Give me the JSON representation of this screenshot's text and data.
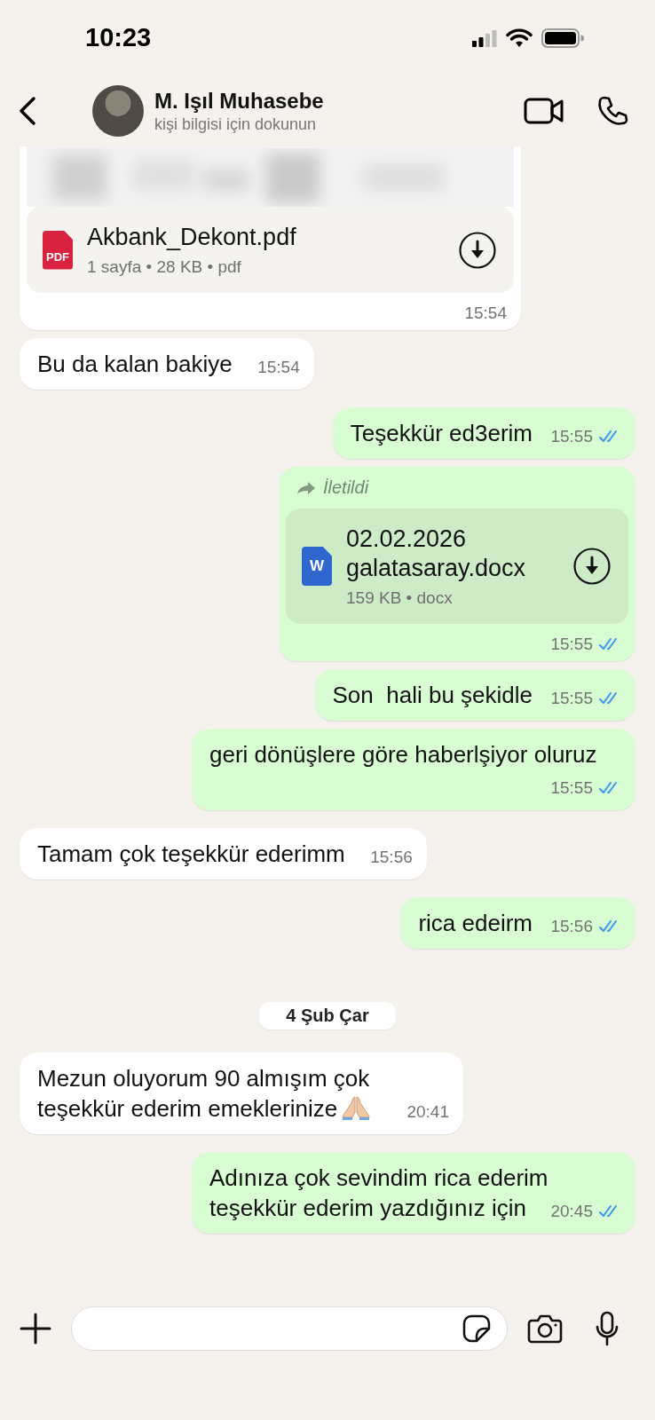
{
  "status_bar": {
    "time": "10:23"
  },
  "header": {
    "name": "M. Işıl Muhasebe",
    "subtitle": "kişi bilgisi için dokunun"
  },
  "messages": [
    {
      "kind": "pdf",
      "outgoing": false,
      "preview": true,
      "icon_label": "PDF",
      "file_name": "Akbank_Dekont.pdf",
      "details": "1 sayfa • 28 KB • pdf",
      "time": "15:54"
    },
    {
      "kind": "text",
      "outgoing": false,
      "text": "Bu da kalan bakiye",
      "time": "15:54"
    },
    {
      "kind": "text",
      "outgoing": true,
      "text": "Teşekkür ed3erim",
      "time": "15:55",
      "read": true
    },
    {
      "kind": "word",
      "outgoing": true,
      "forwarded_label": "İletildi",
      "icon_label": "W",
      "file_name": "02.02.2026 galatasaray.docx",
      "details": "159 KB • docx",
      "time": "15:55",
      "read": true
    },
    {
      "kind": "text",
      "outgoing": true,
      "text": "Son  hali bu şekidle",
      "time": "15:55",
      "read": true
    },
    {
      "kind": "text",
      "outgoing": true,
      "text": "geri dönüşlere göre haberlşiyor oluruz",
      "time": "15:55",
      "read": true
    },
    {
      "kind": "text",
      "outgoing": false,
      "text": "Tamam çok teşekkür ederimm",
      "time": "15:56"
    },
    {
      "kind": "text",
      "outgoing": true,
      "text": "rica edeirm",
      "time": "15:56",
      "read": true
    },
    {
      "kind": "date",
      "text": "4 Şub Çar"
    },
    {
      "kind": "text",
      "outgoing": false,
      "text": "Mezun oluyorum 90 almışım çok teşekkür ederim emeklerinize",
      "praying_emoji": true,
      "time": "20:41"
    },
    {
      "kind": "text",
      "outgoing": true,
      "text": "Adınıza çok sevindim rica ederim teşekkür ederim yazdığınız için",
      "time": "20:45",
      "read": true
    }
  ]
}
